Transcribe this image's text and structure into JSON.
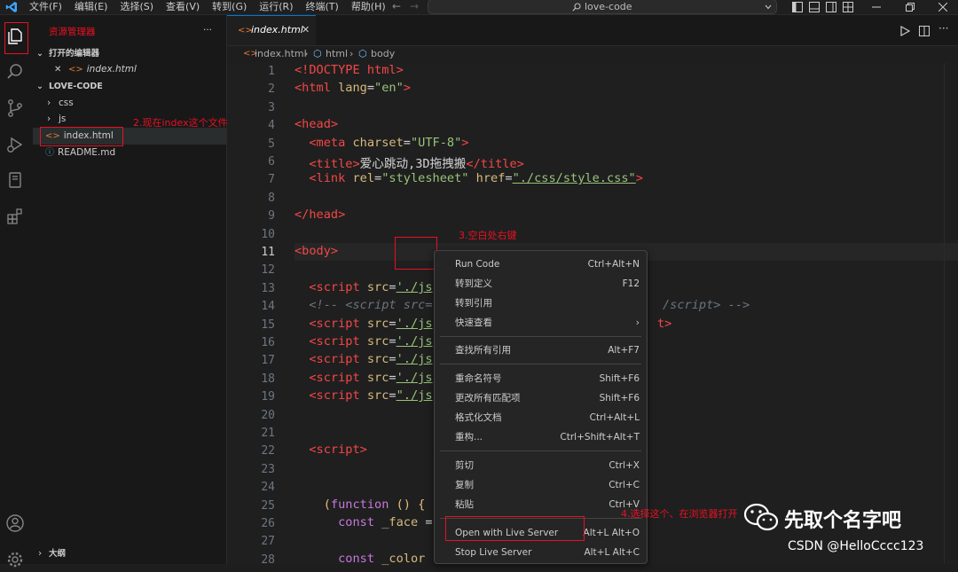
{
  "titlebar": {
    "menus": [
      "文件(F)",
      "编辑(E)",
      "选择(S)",
      "查看(V)",
      "转到(G)",
      "运行(R)",
      "终端(T)",
      "帮助(H)"
    ],
    "search": "love-code",
    "back": "←",
    "forward": "→"
  },
  "sidebar": {
    "title": "资源管理器",
    "more": "···",
    "open_editors_label": "打开的编辑器",
    "open_editor_file": "index.html",
    "close_glyph": "✕",
    "workspace_label": "LOVE-CODE",
    "tree": [
      {
        "name": "css",
        "kind": "folder"
      },
      {
        "name": "js",
        "kind": "folder"
      },
      {
        "name": "index.html",
        "kind": "file"
      },
      {
        "name": "README.md",
        "kind": "file"
      }
    ],
    "outline_label": "大纲"
  },
  "tab": {
    "label": "index.html",
    "close": "✕"
  },
  "breadcrumb": {
    "file": "index.html",
    "sep": "›",
    "items": [
      "html",
      "body"
    ]
  },
  "code_lines": [
    {
      "n": "1"
    },
    {
      "n": "2"
    },
    {
      "n": "3"
    },
    {
      "n": "4"
    },
    {
      "n": "5"
    },
    {
      "n": "6"
    },
    {
      "n": "7"
    },
    {
      "n": "8"
    },
    {
      "n": "9"
    },
    {
      "n": "10"
    },
    {
      "n": "11"
    },
    {
      "n": "12"
    },
    {
      "n": "13"
    },
    {
      "n": "14"
    },
    {
      "n": "15"
    },
    {
      "n": "16"
    },
    {
      "n": "17"
    },
    {
      "n": "18"
    },
    {
      "n": "19"
    },
    {
      "n": "20"
    },
    {
      "n": "21"
    },
    {
      "n": "22"
    },
    {
      "n": "23"
    },
    {
      "n": "24"
    },
    {
      "n": "25"
    },
    {
      "n": "26"
    },
    {
      "n": "27"
    },
    {
      "n": "28"
    }
  ],
  "code": {
    "l1": "<!DOCTYPE html>",
    "l2a": "<html ",
    "l2b": "lang",
    "l2c": "=",
    "l2d": "\"en\"",
    "l2e": ">",
    "l4": "<head>",
    "l5a": "  <meta ",
    "l5b": "charset",
    "l5c": "=",
    "l5d": "\"UTF-8\"",
    "l5e": ">",
    "l6a": "  <title>",
    "l6b": "爱心跳动,3D拖拽搬",
    "l6c": "</title>",
    "l7a": "  <link ",
    "l7b": "rel",
    "l7c": "=",
    "l7d": "\"stylesheet\"",
    "l7e": " href",
    "l7f": "=",
    "l7g": "\"./css/style.css\"",
    "l7h": ">",
    "l9": "</head>",
    "l11": "<body>",
    "l13a": "  <script ",
    "l13b": "src",
    "l13c": "=",
    "l13d": "'./js",
    "l14a": "  <!-- <script src=",
    "l14b": "/script> -->",
    "l15a": "  <script ",
    "l15b": "src",
    "l15c": "=",
    "l15d": "'./js",
    "l15e": "t>",
    "l16a": "  <script ",
    "l16b": "src",
    "l16c": "=",
    "l16d": "'./js",
    "l17a": "  <script ",
    "l17b": "src",
    "l17c": "=",
    "l17d": "'./js",
    "l18a": "  <script ",
    "l18b": "src",
    "l18c": "=",
    "l18d": "'./js",
    "l19a": "  <script ",
    "l19b": "src",
    "l19c": "=",
    "l19d": "\"./js",
    "l22": "  <script>",
    "l25a": "    (",
    "l25b": "function",
    "l25c": " () {",
    "l26a": "      const ",
    "l26b": "_face",
    "l26c": " =",
    "l28a": "      const ",
    "l28b": "_color"
  },
  "context_menu": [
    {
      "label": "Run Code",
      "shortcut": "Ctrl+Alt+N"
    },
    {
      "label": "转到定义",
      "shortcut": "F12"
    },
    {
      "label": "转到引用",
      "shortcut": ""
    },
    {
      "label": "快速查看",
      "shortcut": "›"
    },
    {
      "label": "查找所有引用",
      "shortcut": "Alt+F7"
    },
    {
      "label": "重命名符号",
      "shortcut": "Shift+F6"
    },
    {
      "label": "更改所有匹配项",
      "shortcut": "Shift+F6"
    },
    {
      "label": "格式化文档",
      "shortcut": "Ctrl+Alt+L"
    },
    {
      "label": "重构...",
      "shortcut": "Ctrl+Shift+Alt+T"
    },
    {
      "label": "剪切",
      "shortcut": "Ctrl+X"
    },
    {
      "label": "复制",
      "shortcut": "Ctrl+C"
    },
    {
      "label": "粘贴",
      "shortcut": "Ctrl+V"
    },
    {
      "label": "Open with Live Server",
      "shortcut": "Alt+L Alt+O"
    },
    {
      "label": "Stop Live Server",
      "shortcut": "Alt+L Alt+C"
    }
  ],
  "annotations": {
    "step2": "2.现在index这个文件",
    "step3": "3.空白处右键",
    "step4": "4.选择这个、在浏览器打开"
  },
  "watermark": {
    "name": "先取个名字吧",
    "csdn": "CSDN @HelloCccc123"
  },
  "colors": {
    "accent": "#0078d4",
    "annotation": "#e81123",
    "tag": "#f44747",
    "attr": "#d7ba7d",
    "string": "#98c379"
  }
}
